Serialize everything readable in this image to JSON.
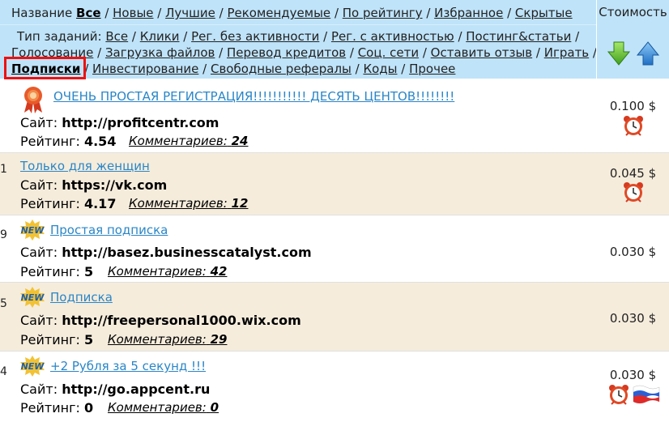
{
  "header": {
    "name_label": "Название",
    "sort_links": [
      "Все",
      "Новые",
      "Лучшие",
      "Рекомендуемые",
      "По рейтингу",
      "Избранное",
      "Скрытые"
    ],
    "cost_label": "Стоимость",
    "type_label": "Тип заданий:",
    "types": [
      "Все",
      "Клики",
      "Рег. без активности",
      "Рег. с активностью",
      "Постинг&статьи",
      "Голосование",
      "Загрузка файлов",
      "Перевод кредитов",
      "Соц. сети",
      "Оставить отзыв",
      "Играть",
      "Подписки",
      "Инвестирование",
      "Свободные рефералы",
      "Коды",
      "Прочее"
    ],
    "selected_type": "Подписки",
    "sort_down_icon": "arrow-down-icon",
    "sort_up_icon": "arrow-up-icon",
    "colors": {
      "header_bg": "#bfe3f9",
      "row_alt_bg": "#f5ecdc",
      "link": "#2a86c7",
      "selected_border": "#e11111"
    }
  },
  "rows": [
    {
      "index": "",
      "badge": "award-ribbon-icon",
      "title": "ОЧЕНЬ ПРОСТАЯ РЕГИСТРАЦИЯ!!!!!!!!!!! ДЕСЯТЬ ЦЕНТОВ!!!!!!!!",
      "site_label": "Сайт:",
      "site": "http://profitcentr.com",
      "rating_label": "Рейтинг:",
      "rating": "4.54",
      "comments_label": "Комментариев:",
      "comments": "24",
      "price": "0.100 $",
      "price_icons": [
        "alarm-clock-icon"
      ]
    },
    {
      "index": "1",
      "badge": "",
      "title": "Только для женщин",
      "site_label": "Сайт:",
      "site": "https://vk.com",
      "rating_label": "Рейтинг:",
      "rating": "4.17",
      "comments_label": "Комментариев:",
      "comments": "12",
      "price": "0.045 $",
      "price_icons": [
        "alarm-clock-icon"
      ]
    },
    {
      "index": "9",
      "badge": "new-badge-icon",
      "title": "Простая подписка",
      "site_label": "Сайт:",
      "site": "http://basez.businesscatalyst.com",
      "rating_label": "Рейтинг:",
      "rating": "5",
      "comments_label": "Комментариев:",
      "comments": "42",
      "price": "0.030 $",
      "price_icons": []
    },
    {
      "index": "5",
      "badge": "new-badge-icon",
      "title": "Подписка",
      "site_label": "Сайт:",
      "site": "http://freepersonal1000.wix.com",
      "rating_label": "Рейтинг:",
      "rating": "5",
      "comments_label": "Комментариев:",
      "comments": "29",
      "price": "0.030 $",
      "price_icons": []
    },
    {
      "index": "4",
      "badge": "new-badge-icon",
      "title": "+2 Рубля за 5 секунд !!!",
      "site_label": "Сайт:",
      "site": "http://go.appcent.ru",
      "rating_label": "Рейтинг:",
      "rating": "0",
      "comments_label": "Комментариев:",
      "comments": "0",
      "price": "0.030 $",
      "price_icons": [
        "alarm-clock-icon",
        "russia-flag-icon"
      ]
    }
  ]
}
